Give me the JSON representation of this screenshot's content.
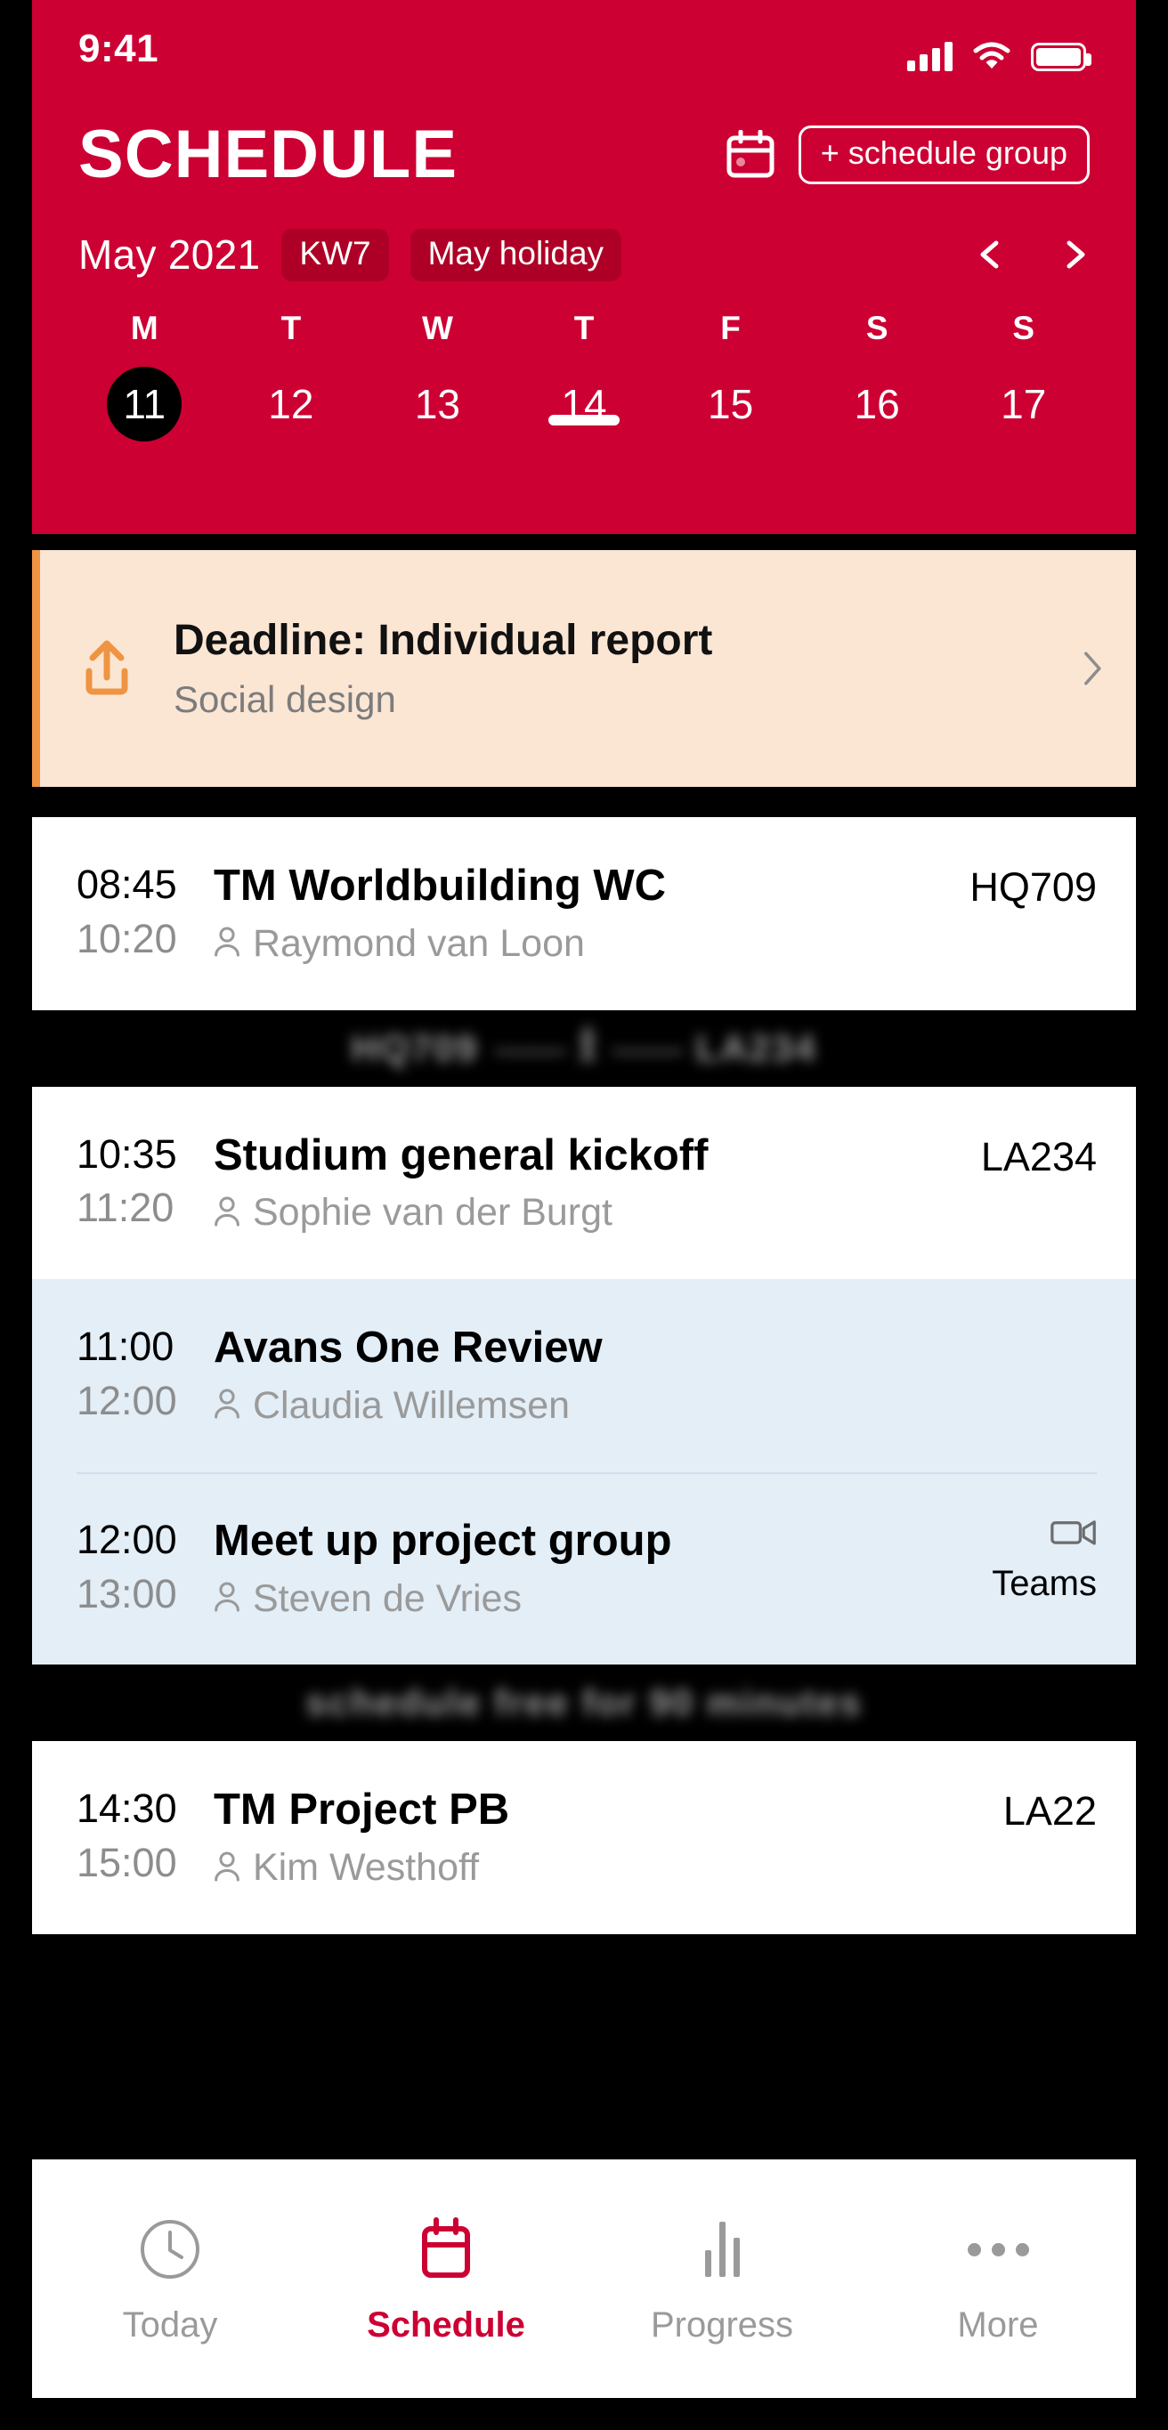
{
  "status": {
    "time": "9:41",
    "signal_icon": "signal-bars-icon",
    "wifi_icon": "wifi-icon",
    "battery_icon": "battery-icon"
  },
  "header": {
    "title": "SCHEDULE",
    "calendar_icon": "calendar-icon",
    "add_group_label": "+ schedule group",
    "month": "May 2021",
    "chips": [
      "KW7",
      "May holiday"
    ],
    "prev_icon": "chevron-left-icon",
    "next_icon": "chevron-right-icon",
    "accent_color": "#cc0033",
    "chip_color": "#ae0026",
    "week": {
      "day_letters": [
        "M",
        "T",
        "W",
        "T",
        "F",
        "S",
        "S"
      ],
      "day_numbers": [
        "11",
        "12",
        "13",
        "14",
        "15",
        "16",
        "17"
      ],
      "selected_index": 0
    }
  },
  "deadline": {
    "icon": "upload-icon",
    "title": "Deadline: Individual report",
    "subtitle": "Social design",
    "chevron_icon": "chevron-right-icon",
    "accent_color": "#ef9443",
    "background_color": "#fbe6d4"
  },
  "events": [
    {
      "start": "08:45",
      "end": "10:20",
      "title": "TM Worldbuilding WC",
      "person": "Raymond van Loon",
      "person_icon": "person-icon",
      "room": "HQ709",
      "highlighted": false
    },
    {
      "start": "10:35",
      "end": "11:20",
      "title": "Studium general kickoff",
      "person": "Sophie van der Burgt",
      "person_icon": "person-icon",
      "room": "LA234",
      "highlighted": false
    },
    {
      "start": "11:00",
      "end": "12:00",
      "title": "Avans One Review",
      "person": "Claudia Willemsen",
      "person_icon": "person-icon",
      "room": "",
      "highlighted": true
    },
    {
      "start": "12:00",
      "end": "13:00",
      "title": "Meet up project group",
      "person": "Steven de Vries",
      "person_icon": "person-icon",
      "room": "",
      "meeting_icon": "video-camera-icon",
      "meeting_label": "Teams",
      "highlighted": true
    },
    {
      "start": "14:30",
      "end": "15:00",
      "title": "TM Project PB",
      "person": "Kim Westhoff",
      "person_icon": "person-icon",
      "room": "LA22",
      "highlighted": false
    }
  ],
  "dividers": {
    "travel_from": "HQ709",
    "travel_dash_left": "——",
    "travel_icon": "walking-person-icon",
    "travel_dash_right": "——",
    "travel_to": "LA234",
    "free_time": "schedule free for 90 minutes"
  },
  "tabbar": {
    "items": [
      {
        "label": "Today",
        "icon": "clock-icon",
        "active": false
      },
      {
        "label": "Schedule",
        "icon": "calendar-icon",
        "active": true
      },
      {
        "label": "Progress",
        "icon": "bar-chart-icon",
        "active": false
      },
      {
        "label": "More",
        "icon": "ellipsis-icon",
        "active": false
      }
    ],
    "active_color": "#cc0033",
    "inactive_color": "#9a9a9a"
  }
}
